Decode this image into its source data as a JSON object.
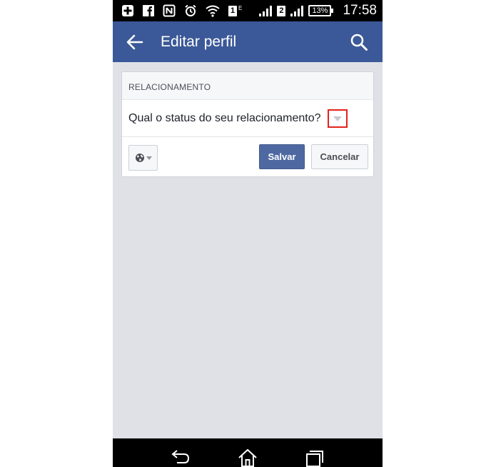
{
  "status_bar": {
    "time": "17:58",
    "battery": "13%",
    "sim_slot": "2",
    "notification_icons": [
      "plus-icon",
      "facebook-icon",
      "nfc-icon",
      "alarm-icon",
      "wifi-icon"
    ],
    "sim_badge": "1",
    "sim_badge_superscript": "E"
  },
  "app_bar": {
    "title": "Editar perfil",
    "color": "#3b5998"
  },
  "card": {
    "section_label": "RELACIONAMENTO",
    "question": "Qual o status do seu relacionamento?",
    "privacy_icon": "globe-icon",
    "save_label": "Salvar",
    "cancel_label": "Cancelar"
  },
  "colors": {
    "highlight_border": "#e3221c",
    "save_button": "#4e69a2",
    "background": "#dfe1e6"
  },
  "nav_bar": {
    "buttons": [
      "back-icon",
      "home-icon",
      "recent-apps-icon"
    ]
  }
}
